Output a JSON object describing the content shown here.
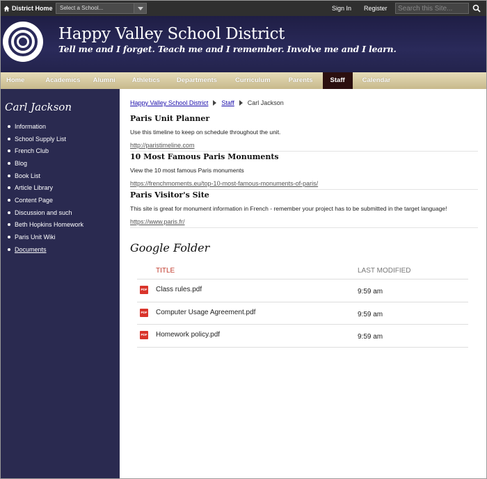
{
  "topbar": {
    "home_label": "District Home",
    "school_select": "Select a School...",
    "sign_in": "Sign In",
    "register": "Register",
    "search_placeholder": "Search this Site..."
  },
  "banner": {
    "title": "Happy Valley School District",
    "tagline": "Tell me and I forget. Teach me and I remember. Involve me and I learn."
  },
  "nav": {
    "items": [
      {
        "label": "Home"
      },
      {
        "label": "Academics"
      },
      {
        "label": "Alumni"
      },
      {
        "label": "Athletics"
      },
      {
        "label": "Departments"
      },
      {
        "label": "Curriculum"
      },
      {
        "label": "Parents"
      },
      {
        "label": "Staff",
        "active": true
      },
      {
        "label": "Calendar"
      }
    ]
  },
  "sidebar": {
    "title": "Carl Jackson",
    "items": [
      {
        "label": "Information"
      },
      {
        "label": "School Supply List"
      },
      {
        "label": "French Club"
      },
      {
        "label": "Blog"
      },
      {
        "label": "Book List"
      },
      {
        "label": "Article Library"
      },
      {
        "label": "Content Page"
      },
      {
        "label": "Discussion and such"
      },
      {
        "label": "Beth Hopkins Homework"
      },
      {
        "label": "Paris Unit Wiki"
      },
      {
        "label": "Documents",
        "current": true
      }
    ]
  },
  "breadcrumb": {
    "items": [
      "Happy Valley School District",
      "Staff"
    ],
    "current": "Carl Jackson"
  },
  "links": [
    {
      "title": "Paris Unit Planner",
      "description": "Use this timeline to keep on schedule throughout the unit.",
      "url": "http://paristimeline.com"
    },
    {
      "title": "10 Most Famous Paris Monuments",
      "description": "View the 10 most famous Paris monuments",
      "url": "https://frenchmoments.eu/top-10-most-famous-monuments-of-paris/"
    },
    {
      "title": "Paris Visitor's Site",
      "description": "This site is great for monument information in French - remember your project has to be submitted in the target language!",
      "url": "https://www.paris.fr/"
    }
  ],
  "folder": {
    "title": "Google Folder",
    "col_title": "TITLE",
    "col_modified": "LAST MODIFIED",
    "icon_text": "PDF",
    "files": [
      {
        "name": "Class rules.pdf",
        "modified": "9:59 am"
      },
      {
        "name": "Computer Usage Agreement.pdf",
        "modified": "9:59 am"
      },
      {
        "name": "Homework policy.pdf",
        "modified": "9:59 am"
      }
    ]
  },
  "colors": {
    "topbar": "#2f2f2f",
    "banner": "#2a2a5a",
    "nav": "#d8cba0",
    "nav_active": "#2b0f0f",
    "sidebar": "#2a2a50",
    "accent_red": "#c0392b"
  }
}
